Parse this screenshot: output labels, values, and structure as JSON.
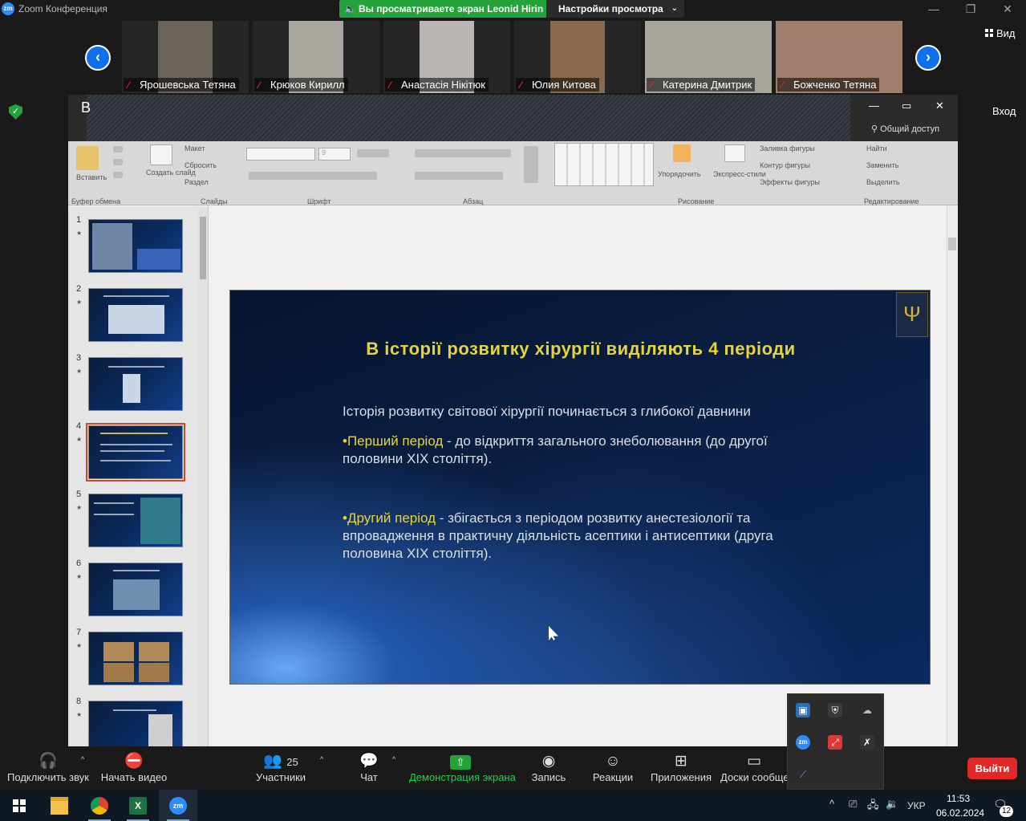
{
  "window": {
    "title": "Zoom Конференция",
    "logo_text": "zm",
    "share_banner": "Вы просматриваете экран Leonid Hirin",
    "view_options": "Настройки просмотра",
    "min": "—",
    "restore": "❐",
    "close": "✕"
  },
  "gallery": {
    "prev": "‹",
    "next": "›",
    "view_label": "Вид",
    "signin_label": "Вход",
    "participants": [
      {
        "name": "Ярошевська Тетяна",
        "color": "#6b6259"
      },
      {
        "name": "Крюков Кирилл",
        "color": "#a9a6a0"
      },
      {
        "name": "Анастасія Нікітюк",
        "color": "#b9b6b3"
      },
      {
        "name": "Юлия Китова",
        "color": "#8a6a4c"
      },
      {
        "name": "Катерина Дмитрик",
        "color": "#a7a59c"
      },
      {
        "name": "Божченко Тетяна",
        "color": "#9f7f6c"
      }
    ]
  },
  "powerpoint": {
    "title_letter": "В",
    "share_label": "Общий доступ",
    "ribbon": {
      "groups": [
        "Буфер обмена",
        "Слайды",
        "Шрифт",
        "Абзац",
        "Рисование",
        "Редактирование"
      ],
      "items": {
        "paste": "Вставить",
        "new_slide": "Создать слайд",
        "layout": "Макет",
        "reset": "Сбросить",
        "section": "Раздел",
        "arrange": "Упорядочить",
        "quick_styles": "Экспресс-стили",
        "shape_fill": "Заливка фигуры",
        "shape_outline": "Контур фигуры",
        "shape_effects": "Эффекты фигуры",
        "find": "Найти",
        "replace": "Заменить",
        "select": "Выделить",
        "font_size": "9"
      }
    },
    "thumbnails": [
      "1",
      "2",
      "3",
      "4",
      "5",
      "6",
      "7",
      "8"
    ],
    "selected_slide": 4
  },
  "slide": {
    "title": "В історії розвитку хірургії виділяють 4 періоди",
    "intro": "Історія розвитку світової хірургії починається з глибокої давнини",
    "period1_name": "•Перший період",
    "period1_text": " - до відкриття загального знеболювання (до другої половини XIX століття).",
    "period2_name": "•Другий період",
    "period2_text": " - збігається з періодом розвитку анестезіології та впровадження в практичну діяльність асептики і антисептики (друга половина XIX століття).",
    "crest": "Ψ"
  },
  "toolbar": {
    "audio": "Подключить звук",
    "video": "Начать видео",
    "participants": "Участники",
    "participants_count": "25",
    "chat": "Чат",
    "share": "Демонстрация экрана",
    "record": "Запись",
    "reactions": "Реакции",
    "apps": "Приложения",
    "whiteboards": "Доски сообще",
    "leave": "Выйти",
    "caret": "^"
  },
  "taskbar": {
    "lang": "УКР",
    "time": "11:53",
    "date": "06.02.2024",
    "notifications": "12",
    "up_arrow": "^"
  },
  "colors": {
    "accent_green": "#23a33a",
    "zoom_blue": "#0e71eb",
    "leave_red": "#e02828",
    "slide_title_yellow": "#e6d43c"
  }
}
